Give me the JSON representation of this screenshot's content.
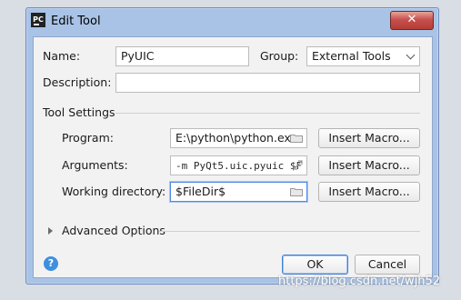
{
  "window": {
    "title": "Edit Tool",
    "close_label": "✕"
  },
  "form": {
    "name_label": "Name:",
    "name_value": "PyUIC",
    "group_label": "Group:",
    "group_value": "External Tools",
    "description_label": "Description:",
    "description_value": ""
  },
  "tool_settings": {
    "section_label": "Tool Settings",
    "program_label": "Program:",
    "program_value": "E:\\python\\python.exe",
    "arguments_label": "Arguments:",
    "arguments_value": "-m PyQt5.uic.pyuic $F",
    "working_dir_label": "Working directory:",
    "working_dir_value": "$FileDir$",
    "insert_macro_label": "Insert Macro..."
  },
  "advanced": {
    "label": "Advanced Options"
  },
  "footer": {
    "help_label": "?",
    "ok_label": "OK",
    "cancel_label": "Cancel"
  },
  "watermark": {
    "text": "https://blog.csdn.net/wjh52"
  },
  "colors": {
    "accent": "#3f7fd6",
    "titlebar": "#a9c3e6",
    "close_button": "#c75050",
    "help_icon": "#3f8fe0"
  }
}
